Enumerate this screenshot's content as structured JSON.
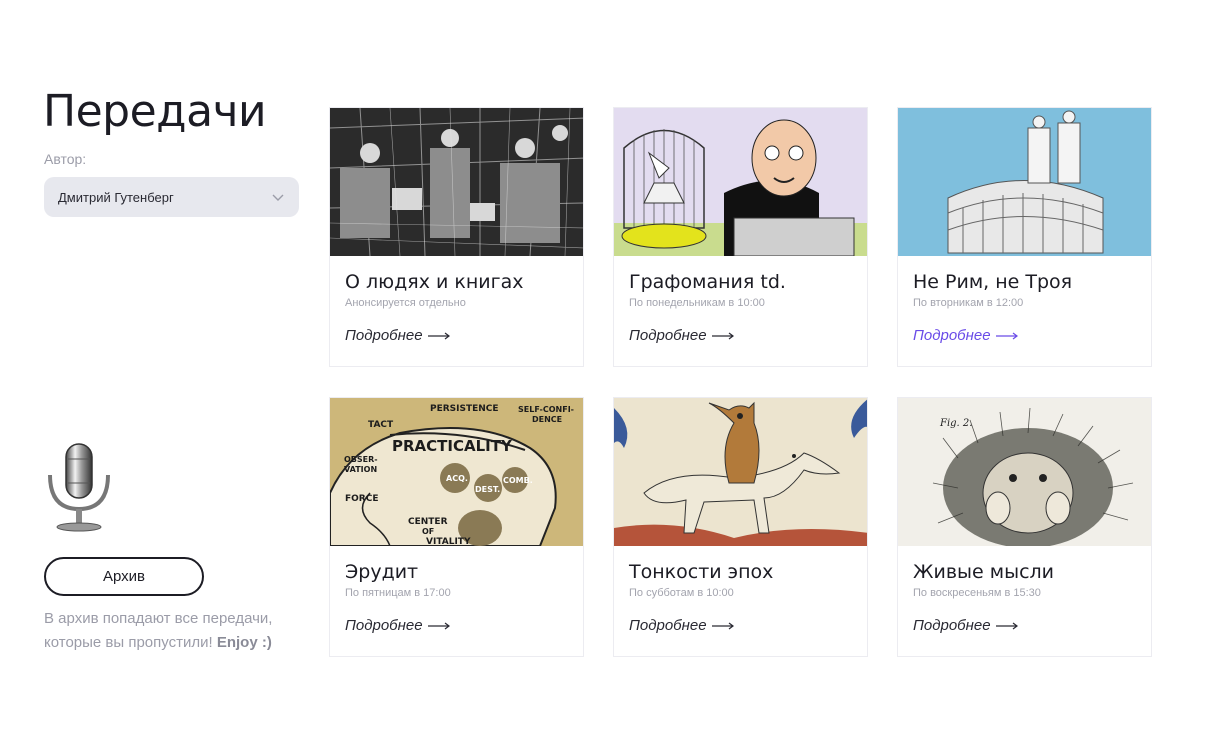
{
  "page": {
    "title": "Передачи"
  },
  "filter": {
    "label": "Автор:",
    "selected": "Дмитрий Гутенберг"
  },
  "archive": {
    "button_label": "Архив",
    "note": "В архив попадают все передачи, которые вы пропустили!",
    "note_emphasis": "Enjoy :)"
  },
  "shows": [
    {
      "title": "О людях и книгах",
      "schedule": "Анонсируется отдельно",
      "more": "Подробнее"
    },
    {
      "title": "Графомания td.",
      "schedule": "По понедельникам в 10:00",
      "more": "Подробнее"
    },
    {
      "title": "Не Рим, не Троя",
      "schedule": "По вторникам в 12:00",
      "more": "Подробнее"
    },
    {
      "title": "Эрудит",
      "schedule": "По пятницам в 17:00",
      "more": "Подробнее"
    },
    {
      "title": "Тонкости эпох",
      "schedule": "По субботам в 10:00",
      "more": "Подробнее"
    },
    {
      "title": "Живые мысли",
      "schedule": "По воскресеньям в 15:30",
      "more": "Подробнее"
    }
  ],
  "images": {
    "phrenology_words": [
      "PERSISTENCE",
      "SELF-CONFI-",
      "DENCE",
      "TACT",
      "PRACTICALITY",
      "OBSER-",
      "VATION",
      "FORCE",
      "ACQ.",
      "DEST.",
      "COMB.",
      "CENTER",
      "OF",
      "VITALITY"
    ],
    "engraving_caption": "Fig. 2."
  },
  "colors": {
    "accent": "#6a4ce8",
    "text": "#1c1c24",
    "muted": "#9b9ca8",
    "select_bg": "#e7e8ee"
  }
}
